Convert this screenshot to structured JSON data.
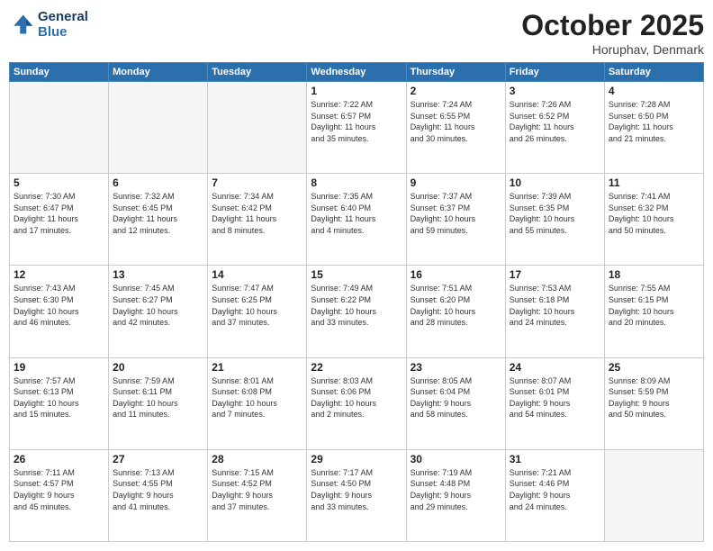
{
  "header": {
    "logo_line1": "General",
    "logo_line2": "Blue",
    "month": "October 2025",
    "location": "Horuphav, Denmark"
  },
  "days_of_week": [
    "Sunday",
    "Monday",
    "Tuesday",
    "Wednesday",
    "Thursday",
    "Friday",
    "Saturday"
  ],
  "weeks": [
    [
      {
        "day": "",
        "info": ""
      },
      {
        "day": "",
        "info": ""
      },
      {
        "day": "",
        "info": ""
      },
      {
        "day": "1",
        "info": "Sunrise: 7:22 AM\nSunset: 6:57 PM\nDaylight: 11 hours\nand 35 minutes."
      },
      {
        "day": "2",
        "info": "Sunrise: 7:24 AM\nSunset: 6:55 PM\nDaylight: 11 hours\nand 30 minutes."
      },
      {
        "day": "3",
        "info": "Sunrise: 7:26 AM\nSunset: 6:52 PM\nDaylight: 11 hours\nand 26 minutes."
      },
      {
        "day": "4",
        "info": "Sunrise: 7:28 AM\nSunset: 6:50 PM\nDaylight: 11 hours\nand 21 minutes."
      }
    ],
    [
      {
        "day": "5",
        "info": "Sunrise: 7:30 AM\nSunset: 6:47 PM\nDaylight: 11 hours\nand 17 minutes."
      },
      {
        "day": "6",
        "info": "Sunrise: 7:32 AM\nSunset: 6:45 PM\nDaylight: 11 hours\nand 12 minutes."
      },
      {
        "day": "7",
        "info": "Sunrise: 7:34 AM\nSunset: 6:42 PM\nDaylight: 11 hours\nand 8 minutes."
      },
      {
        "day": "8",
        "info": "Sunrise: 7:35 AM\nSunset: 6:40 PM\nDaylight: 11 hours\nand 4 minutes."
      },
      {
        "day": "9",
        "info": "Sunrise: 7:37 AM\nSunset: 6:37 PM\nDaylight: 10 hours\nand 59 minutes."
      },
      {
        "day": "10",
        "info": "Sunrise: 7:39 AM\nSunset: 6:35 PM\nDaylight: 10 hours\nand 55 minutes."
      },
      {
        "day": "11",
        "info": "Sunrise: 7:41 AM\nSunset: 6:32 PM\nDaylight: 10 hours\nand 50 minutes."
      }
    ],
    [
      {
        "day": "12",
        "info": "Sunrise: 7:43 AM\nSunset: 6:30 PM\nDaylight: 10 hours\nand 46 minutes."
      },
      {
        "day": "13",
        "info": "Sunrise: 7:45 AM\nSunset: 6:27 PM\nDaylight: 10 hours\nand 42 minutes."
      },
      {
        "day": "14",
        "info": "Sunrise: 7:47 AM\nSunset: 6:25 PM\nDaylight: 10 hours\nand 37 minutes."
      },
      {
        "day": "15",
        "info": "Sunrise: 7:49 AM\nSunset: 6:22 PM\nDaylight: 10 hours\nand 33 minutes."
      },
      {
        "day": "16",
        "info": "Sunrise: 7:51 AM\nSunset: 6:20 PM\nDaylight: 10 hours\nand 28 minutes."
      },
      {
        "day": "17",
        "info": "Sunrise: 7:53 AM\nSunset: 6:18 PM\nDaylight: 10 hours\nand 24 minutes."
      },
      {
        "day": "18",
        "info": "Sunrise: 7:55 AM\nSunset: 6:15 PM\nDaylight: 10 hours\nand 20 minutes."
      }
    ],
    [
      {
        "day": "19",
        "info": "Sunrise: 7:57 AM\nSunset: 6:13 PM\nDaylight: 10 hours\nand 15 minutes."
      },
      {
        "day": "20",
        "info": "Sunrise: 7:59 AM\nSunset: 6:11 PM\nDaylight: 10 hours\nand 11 minutes."
      },
      {
        "day": "21",
        "info": "Sunrise: 8:01 AM\nSunset: 6:08 PM\nDaylight: 10 hours\nand 7 minutes."
      },
      {
        "day": "22",
        "info": "Sunrise: 8:03 AM\nSunset: 6:06 PM\nDaylight: 10 hours\nand 2 minutes."
      },
      {
        "day": "23",
        "info": "Sunrise: 8:05 AM\nSunset: 6:04 PM\nDaylight: 9 hours\nand 58 minutes."
      },
      {
        "day": "24",
        "info": "Sunrise: 8:07 AM\nSunset: 6:01 PM\nDaylight: 9 hours\nand 54 minutes."
      },
      {
        "day": "25",
        "info": "Sunrise: 8:09 AM\nSunset: 5:59 PM\nDaylight: 9 hours\nand 50 minutes."
      }
    ],
    [
      {
        "day": "26",
        "info": "Sunrise: 7:11 AM\nSunset: 4:57 PM\nDaylight: 9 hours\nand 45 minutes."
      },
      {
        "day": "27",
        "info": "Sunrise: 7:13 AM\nSunset: 4:55 PM\nDaylight: 9 hours\nand 41 minutes."
      },
      {
        "day": "28",
        "info": "Sunrise: 7:15 AM\nSunset: 4:52 PM\nDaylight: 9 hours\nand 37 minutes."
      },
      {
        "day": "29",
        "info": "Sunrise: 7:17 AM\nSunset: 4:50 PM\nDaylight: 9 hours\nand 33 minutes."
      },
      {
        "day": "30",
        "info": "Sunrise: 7:19 AM\nSunset: 4:48 PM\nDaylight: 9 hours\nand 29 minutes."
      },
      {
        "day": "31",
        "info": "Sunrise: 7:21 AM\nSunset: 4:46 PM\nDaylight: 9 hours\nand 24 minutes."
      },
      {
        "day": "",
        "info": ""
      }
    ]
  ]
}
